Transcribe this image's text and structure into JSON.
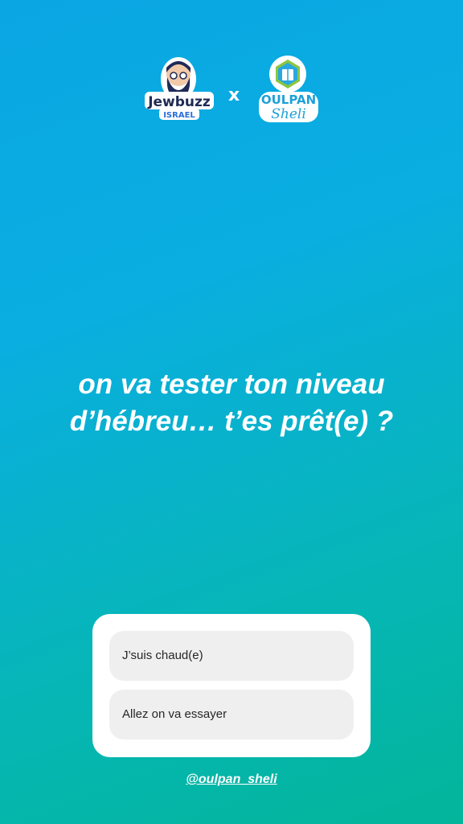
{
  "header": {
    "left_logo": {
      "line1": "Jewbuzz",
      "line2": "ISRAEL",
      "icon": "bearded-man-icon"
    },
    "separator": "x",
    "right_logo": {
      "line1": "OULPAN",
      "line2": "Sheli",
      "icon": "hexagon-book-icon"
    }
  },
  "question": {
    "line1": "on va tester ton niveau",
    "line2": "d’hébreu… t’es prêt(e) ?"
  },
  "poll": {
    "options": [
      {
        "label": "J’suis chaud(e)"
      },
      {
        "label": "Allez on va essayer"
      }
    ]
  },
  "mention": "@oulpan_sheli",
  "colors": {
    "background_top": "#0aa6e4",
    "background_bottom": "#03b59a",
    "poll_bg": "#ffffff",
    "option_bg": "#efefef"
  }
}
